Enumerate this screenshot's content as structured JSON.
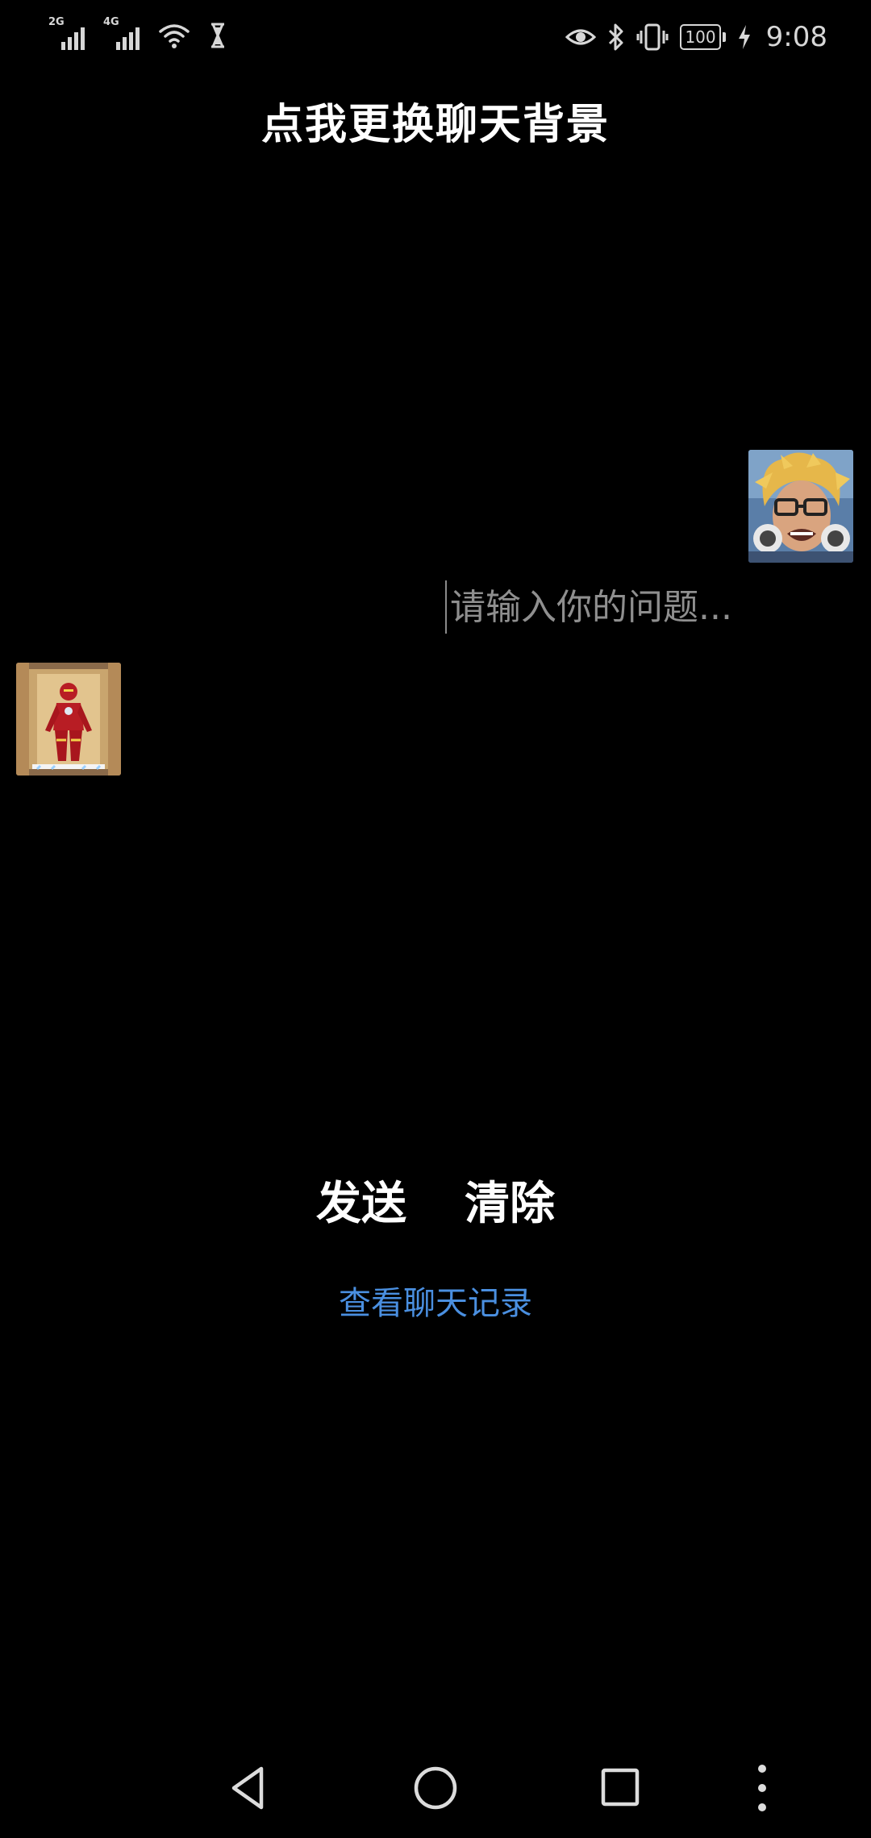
{
  "status_bar": {
    "signal_1_label": "2G",
    "signal_2_label": "4G",
    "battery_level": "100",
    "time": "9:08",
    "icons": [
      "signal-2g-icon",
      "signal-4g-icon",
      "wifi-icon",
      "hourglass-icon",
      "eye-icon",
      "bluetooth-icon",
      "vibrate-icon",
      "battery-icon",
      "charging-icon"
    ]
  },
  "header": {
    "title": "点我更换聊天背景"
  },
  "chat": {
    "user_avatar": "user-avatar",
    "bot_avatar": "bot-avatar",
    "input_placeholder": "请输入你的问题..."
  },
  "actions": {
    "send_label": "发送",
    "clear_label": "清除",
    "history_label": "查看聊天记录"
  },
  "colors": {
    "background": "#000000",
    "text": "#ffffff",
    "placeholder": "#8f8f8f",
    "link": "#4a8fe0"
  },
  "nav_bar": {
    "icons": [
      "back-icon",
      "home-icon",
      "recent-apps-icon",
      "more-icon"
    ]
  }
}
